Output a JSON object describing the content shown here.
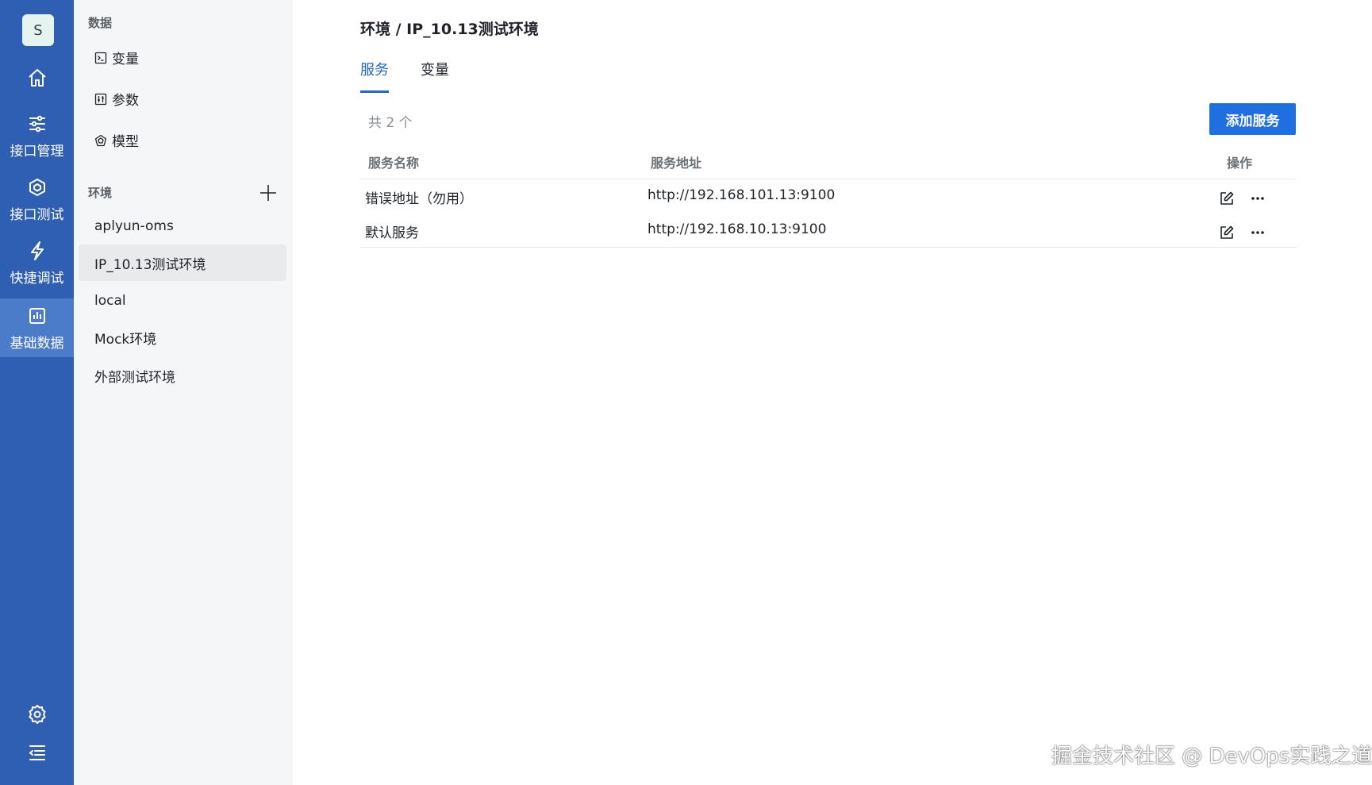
{
  "rail": {
    "avatar_letter": "S",
    "items": [
      {
        "label": ""
      },
      {
        "label": "接口管理"
      },
      {
        "label": "接口测试"
      },
      {
        "label": "快捷调试"
      },
      {
        "label": "基础数据"
      }
    ]
  },
  "panel": {
    "data_section_title": "数据",
    "data_items": [
      {
        "label": "变量",
        "icon": "terminal-icon"
      },
      {
        "label": "参数",
        "icon": "params-icon"
      },
      {
        "label": "模型",
        "icon": "model-icon"
      }
    ],
    "env_section_title": "环境",
    "environments": [
      {
        "label": "aplyun-oms"
      },
      {
        "label": "IP_10.13测试环境"
      },
      {
        "label": "local"
      },
      {
        "label": "Mock环境"
      },
      {
        "label": "外部测试环境"
      }
    ]
  },
  "main": {
    "breadcrumb": "环境 / IP_10.13测试环境",
    "tabs": [
      {
        "label": "服务"
      },
      {
        "label": "变量"
      }
    ],
    "count_text": "共 2 个",
    "add_button_label": "添加服务",
    "columns": [
      "服务名称",
      "服务地址",
      "操作"
    ],
    "rows": [
      {
        "name": "错误地址（勿用）",
        "address": "http://192.168.101.13:9100"
      },
      {
        "name": "默认服务",
        "address": "http://192.168.10.13:9100"
      }
    ]
  },
  "watermark": "掘金技术社区 @ DevOps实践之道",
  "colors": {
    "rail": "#2f5fb3",
    "accent": "#1f6fe0",
    "tab_active": "#2467c9"
  }
}
